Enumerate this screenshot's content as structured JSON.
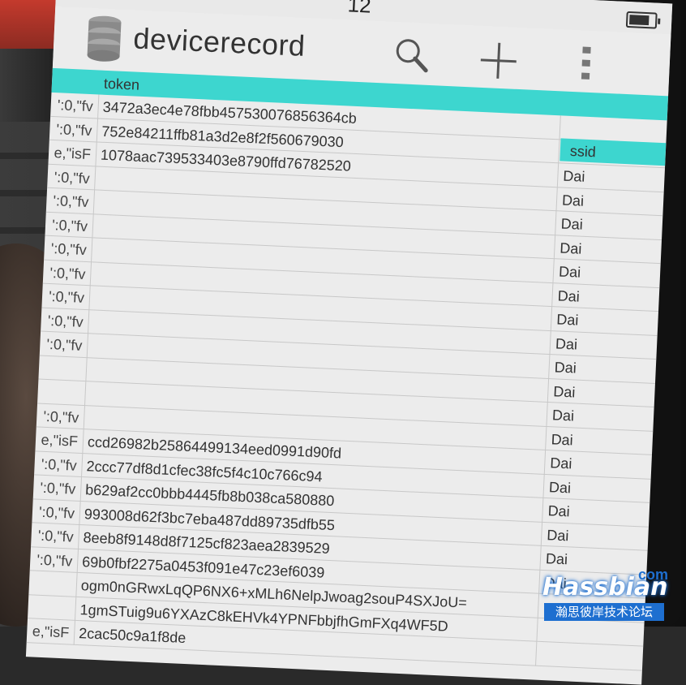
{
  "status": {
    "time": "12",
    "battery_level": 0.8
  },
  "app": {
    "title": "devicerecord",
    "icon": "database-icon"
  },
  "toolbar": {
    "search_icon": "search-icon",
    "add_icon": "plus-icon",
    "more_icon": "more-vertical-icon"
  },
  "columns": {
    "token": "token",
    "ssid": "ssid"
  },
  "rows": [
    {
      "left": "':0,\"fv",
      "token": "3472a3ec4e78fbb457530076856364cb",
      "ssid": ""
    },
    {
      "left": "':0,\"fv",
      "token": "752e84211ffb81a3d2e8f2f560679030",
      "ssid": "Dai"
    },
    {
      "left": "e,\"isF",
      "token": "1078aac739533403e8790ffd76782520",
      "ssid": "Dai"
    },
    {
      "left": "':0,\"fv",
      "token": "",
      "ssid": "Dai"
    },
    {
      "left": "':0,\"fv",
      "token": "",
      "ssid": "Dai"
    },
    {
      "left": "':0,\"fv",
      "token": "",
      "ssid": "Dai"
    },
    {
      "left": "':0,\"fv",
      "token": "",
      "ssid": "Dai"
    },
    {
      "left": "':0,\"fv",
      "token": "",
      "ssid": "Dai"
    },
    {
      "left": "':0,\"fv",
      "token": "",
      "ssid": "Dai"
    },
    {
      "left": "':0,\"fv",
      "token": "",
      "ssid": "Dai"
    },
    {
      "left": "':0,\"fv",
      "token": "",
      "ssid": "Dai"
    },
    {
      "left": "",
      "token": "",
      "ssid": "Dai"
    },
    {
      "left": "",
      "token": "",
      "ssid": "Dai"
    },
    {
      "left": "':0,\"fv",
      "token": "",
      "ssid": "Dai"
    },
    {
      "left": "e,\"isF",
      "token": "ccd26982b25864499134eed0991d90fd",
      "ssid": "Dai"
    },
    {
      "left": "':0,\"fv",
      "token": "2ccc77df8d1cfec38fc5f4c10c766c94",
      "ssid": "Dai"
    },
    {
      "left": "':0,\"fv",
      "token": "b629af2cc0bbb4445fb8b038ca580880",
      "ssid": "Dai"
    },
    {
      "left": "':0,\"fv",
      "token": "993008d62f3bc7eba487dd89735dfb55",
      "ssid": "Dai"
    },
    {
      "left": "':0,\"fv",
      "token": "8eeb8f9148d8f7125cf823aea2839529",
      "ssid": "Dai"
    },
    {
      "left": "':0,\"fv",
      "token": "69b0fbf2275a0453f091e47c23ef6039",
      "ssid": "Dai"
    },
    {
      "left": "",
      "token": "ogm0nGRwxLqQP6NX6+xMLh6NelpJwoag2souP4SXJoU=",
      "ssid": ""
    },
    {
      "left": "",
      "token": "1gmSTuig9u6YXAzC8kEHVk4YPNFbbjfhGmFXq4WF5D",
      "ssid": ""
    },
    {
      "left": "e,\"isF",
      "token": "2cac50c9a1f8de",
      "ssid": ""
    }
  ],
  "watermark": {
    "brand": "Hassbian",
    "suffix": "com",
    "tagline": "瀚思彼岸技术论坛"
  },
  "colors": {
    "header": "#3dd6cf",
    "screen": "#ececec",
    "watermark": "#1e6fd0"
  }
}
